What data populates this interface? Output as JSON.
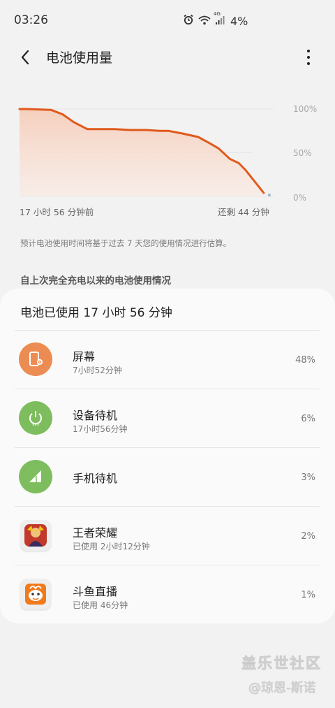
{
  "status_bar": {
    "time": "03:26",
    "battery": "4%",
    "network": "4G",
    "icons": [
      "alarm-icon",
      "wifi-icon",
      "signal-icon"
    ]
  },
  "app_bar": {
    "title": "电池使用量",
    "icons": [
      "back-arrow-icon",
      "more-vert-icon"
    ]
  },
  "chart_data": {
    "type": "area",
    "y_tick_labels": [
      "100%",
      "50%",
      "0%"
    ],
    "ylim": [
      0,
      100
    ],
    "x_start_label": "17 小时 56 分钟前",
    "x_end_label": "还剩 44 分钟",
    "series": [
      {
        "x": [
          0,
          0.03,
          0.14,
          0.19,
          0.24,
          0.3,
          0.36,
          0.42,
          0.49,
          0.56,
          0.62,
          0.66,
          0.72,
          0.79,
          0.84,
          0.88,
          0.93,
          0.97,
          1.0
        ],
        "y": [
          100,
          100,
          99,
          94,
          85,
          77,
          77,
          77,
          76,
          76,
          75,
          75,
          72,
          68,
          61,
          55,
          43,
          38,
          30
        ]
      }
    ],
    "projection_end": {
      "x": 1.08,
      "y": 4
    },
    "line_color": "#e0591b",
    "fill_color": "#f7d2c2",
    "grid": true
  },
  "note": "预计电池使用时间将基于过去 7 天您的使用情况进行估算。",
  "section_title": "自上次完全充电以来的电池使用情况",
  "usage_card": {
    "header": "电池已使用 17 小时 56 分钟",
    "items": [
      {
        "name": "屏幕",
        "sub": "7小时52分钟",
        "pct": "48%",
        "icon": "screen-settings-icon",
        "color": "#ec8c52"
      },
      {
        "name": "设备待机",
        "sub": "17小时56分钟",
        "pct": "6%",
        "icon": "power-icon",
        "color": "#7dbd5e"
      },
      {
        "name": "手机待机",
        "sub": "",
        "pct": "3%",
        "icon": "cell-signal-icon",
        "color": "#7dbd5e"
      },
      {
        "name": "王者荣耀",
        "sub": "已使用 2小时12分钟",
        "pct": "2%",
        "icon": "honor-of-kings-app-icon",
        "color": "#c0392b"
      },
      {
        "name": "斗鱼直播",
        "sub": "已使用 46分钟",
        "pct": "1%",
        "icon": "douyu-app-icon",
        "color": "#f07a1c"
      }
    ]
  },
  "watermark": {
    "line1": "盖乐世社区",
    "line2": "@琼恩-斯诺"
  }
}
